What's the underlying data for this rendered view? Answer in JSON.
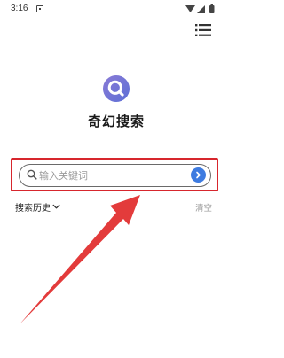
{
  "status_bar": {
    "time": "3:16",
    "icons": [
      "notification-icon",
      "wifi-icon",
      "signal-icon",
      "battery-icon"
    ]
  },
  "header": {
    "menu_icon": "hamburger-menu-icon"
  },
  "app": {
    "logo_icon": "search-logo-icon",
    "title": "奇幻搜索",
    "accent_color": "#3e7be0",
    "logo_color": "#6d6fd0"
  },
  "search": {
    "placeholder": "输入关键词",
    "value": "",
    "search_icon": "search-icon",
    "go_icon": "chevron-right-icon"
  },
  "history": {
    "label": "搜索历史",
    "clear_label": "清空",
    "expand_icon": "chevron-down-icon"
  },
  "annotation": {
    "highlight_color": "#d7262d",
    "arrow_color": "#e33b3b"
  }
}
